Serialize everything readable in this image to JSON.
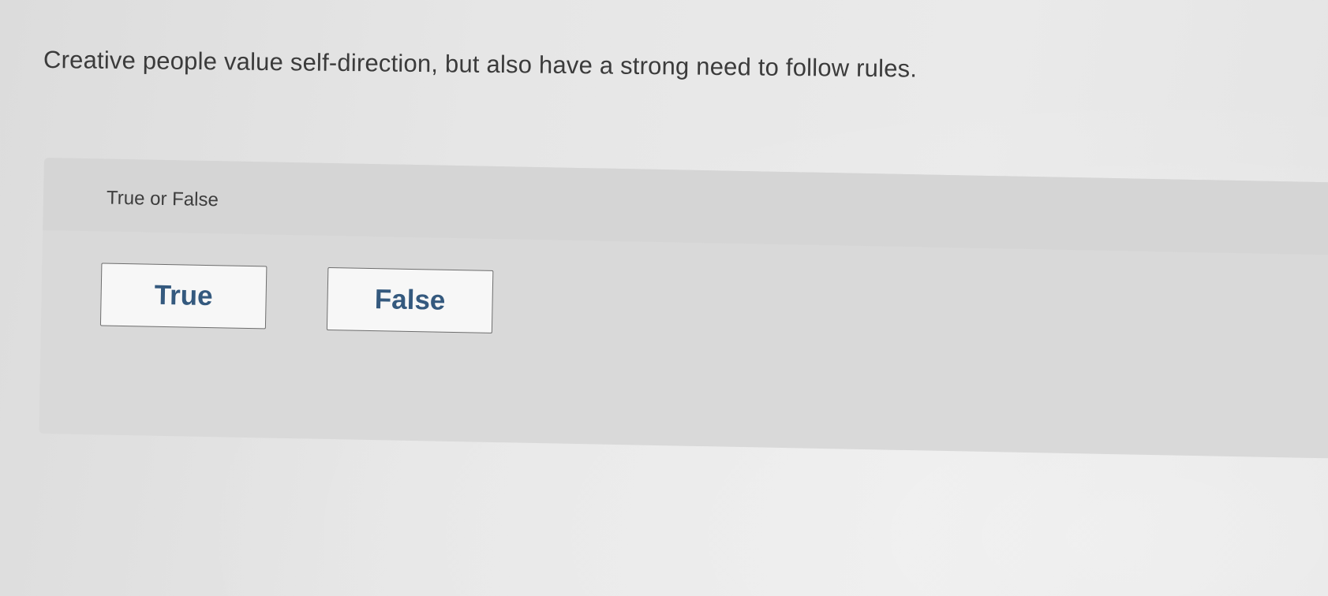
{
  "question": {
    "text": "Creative people value self-direction, but also have a strong need to follow rules."
  },
  "answer_panel": {
    "prompt_label": "True or False",
    "choices": [
      {
        "label": "True"
      },
      {
        "label": "False"
      }
    ]
  },
  "colors": {
    "background": "#e6e6e6",
    "panel": "#d9d9d9",
    "button_bg": "#f7f7f7",
    "button_border": "#6e6e6e",
    "button_text": "#34597e",
    "text": "#3b3b3b"
  }
}
